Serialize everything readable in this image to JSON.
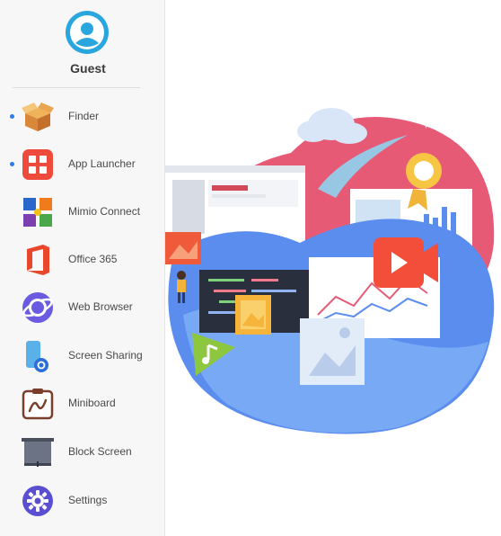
{
  "user": {
    "name": "Guest",
    "avatar_icon": "user-avatar-icon"
  },
  "menu": {
    "items": [
      {
        "label": "Finder",
        "icon": "finder-box-icon",
        "active_indicator": true
      },
      {
        "label": "App Launcher",
        "icon": "app-launcher-icon",
        "active_indicator": true
      },
      {
        "label": "Mimio Connect",
        "icon": "mimio-connect-icon",
        "active_indicator": false
      },
      {
        "label": "Office 365",
        "icon": "office-365-icon",
        "active_indicator": false
      },
      {
        "label": "Web Browser",
        "icon": "web-browser-icon",
        "active_indicator": false
      },
      {
        "label": "Screen Sharing",
        "icon": "screen-sharing-icon",
        "active_indicator": false
      },
      {
        "label": "Miniboard",
        "icon": "miniboard-icon",
        "active_indicator": false
      },
      {
        "label": "Block Screen",
        "icon": "block-screen-icon",
        "active_indicator": false
      },
      {
        "label": "Settings",
        "icon": "settings-gear-icon",
        "active_indicator": false
      }
    ]
  },
  "colors": {
    "accent": "#2b7de9",
    "avatar": "#2aa6de",
    "sidebar_bg": "#f7f7f8",
    "blob_blue": "#5b8def",
    "blob_red": "#e75a76",
    "video_red": "#f24e3a"
  }
}
